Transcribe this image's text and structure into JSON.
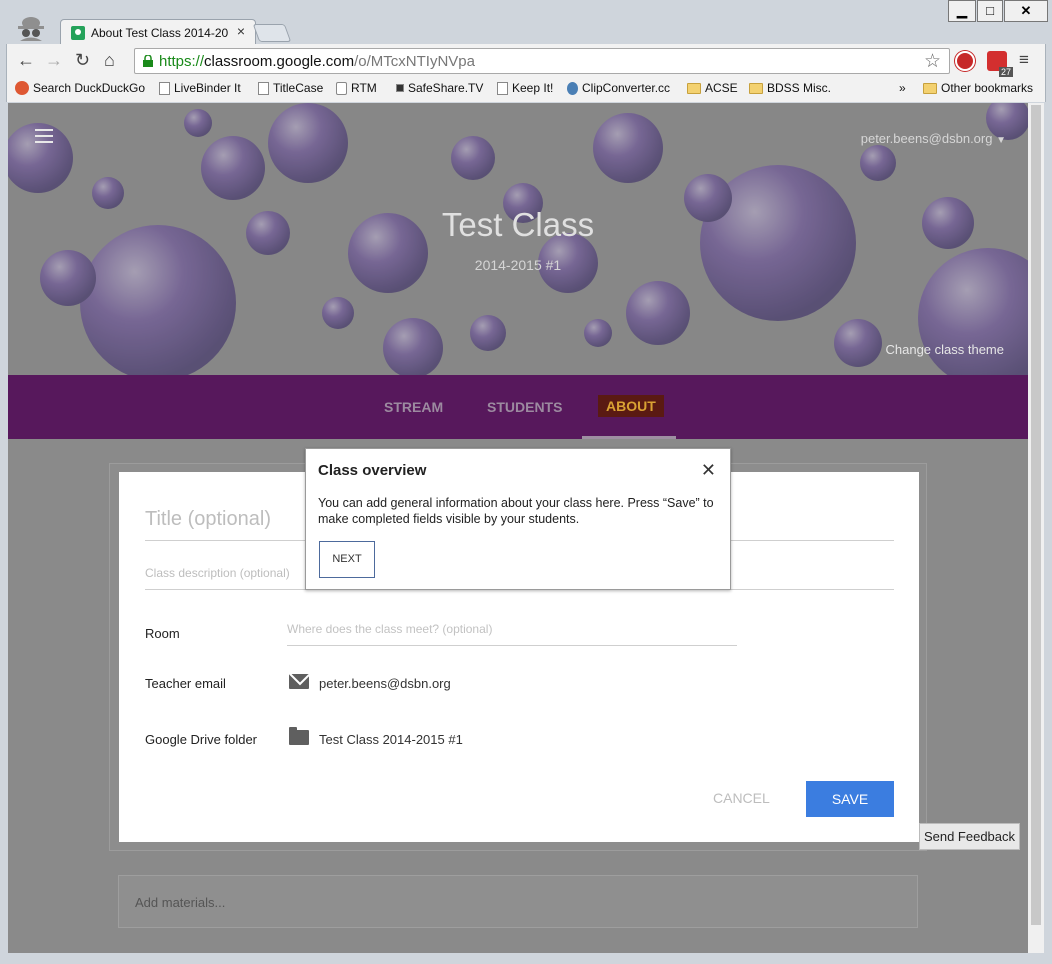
{
  "browser": {
    "tab_title": "About Test Class 2014-201",
    "window_controls": {
      "minimize": "▁",
      "maximize": "□",
      "close": "✕"
    },
    "url_secure": "https://",
    "url_domain": "classroom.google.com",
    "url_path": "/o/MTcxNTIyNVpa",
    "extension_badge": "27",
    "bookmarks": [
      {
        "label": "Search DuckDuckGo"
      },
      {
        "label": "LiveBinder It"
      },
      {
        "label": "TitleCase"
      },
      {
        "label": "RTM"
      },
      {
        "label": "SafeShare.TV"
      },
      {
        "label": "Keep It!"
      },
      {
        "label": "ClipConverter.cc"
      },
      {
        "label": "ACSE"
      },
      {
        "label": "BDSS Misc."
      }
    ],
    "overflow": "»",
    "other_bookmarks": "Other bookmarks"
  },
  "header": {
    "account": "peter.beens@dsbn.org",
    "class_title": "Test Class",
    "class_subtitle": "2014-2015 #1",
    "change_theme": "Change class theme"
  },
  "nav": {
    "tabs": [
      {
        "label": "STREAM"
      },
      {
        "label": "STUDENTS"
      },
      {
        "label": "ABOUT",
        "active": true
      }
    ]
  },
  "form": {
    "title_placeholder": "Title (optional)",
    "description_placeholder": "Class description (optional)",
    "room_label": "Room",
    "room_placeholder": "Where does the class meet? (optional)",
    "teacher_email_label": "Teacher email",
    "teacher_email": "peter.beens@dsbn.org",
    "drive_folder_label": "Google Drive folder",
    "drive_folder": "Test Class 2014-2015 #1",
    "cancel_label": "CANCEL",
    "save_label": "SAVE"
  },
  "materials": {
    "placeholder": "Add materials..."
  },
  "feedback": {
    "label": "Send Feedback"
  },
  "popup": {
    "title": "Class overview",
    "close": "✕",
    "body": "You can add general information about your class here. Press “Save” to make completed fields visible by your students.",
    "next_label": "NEXT"
  },
  "colors": {
    "nav_purple": "#57185c",
    "save_blue": "#3b7de0",
    "active_tab": "#d9a233"
  }
}
